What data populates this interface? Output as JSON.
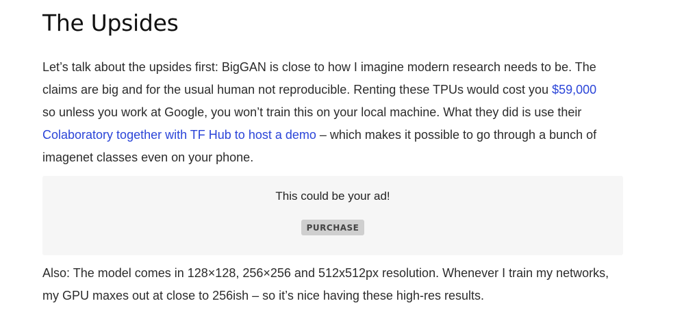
{
  "section": {
    "title": "The Upsides"
  },
  "paragraph1": {
    "text_a": "Let’s talk about the upsides first: BigGAN is close to how I imagine modern research needs to be. The claims are big and for the usual human not reproducible. Renting these TPUs would cost you ",
    "link_cost": "$59,000",
    "text_b": " so unless you work at Google, you won’t train this on your local machine. What they did is use their ",
    "link_colab": "Colaboratory together with TF Hub to host a demo",
    "text_c": " – which makes it possible to go through a bunch of imagenet classes even on your phone."
  },
  "ad": {
    "text": "This could be your ad!",
    "button_label": "PURCHASE"
  },
  "paragraph2": {
    "text": "Also: The model comes in 128×128, 256×256 and 512x512px resolution. Whenever I train my networks, my GPU maxes out at close to 256ish – so it’s nice having these high-res results."
  },
  "colors": {
    "link": "#2a44d8",
    "ad_background": "#f6f6f6",
    "button_background": "#cfcfcf"
  }
}
